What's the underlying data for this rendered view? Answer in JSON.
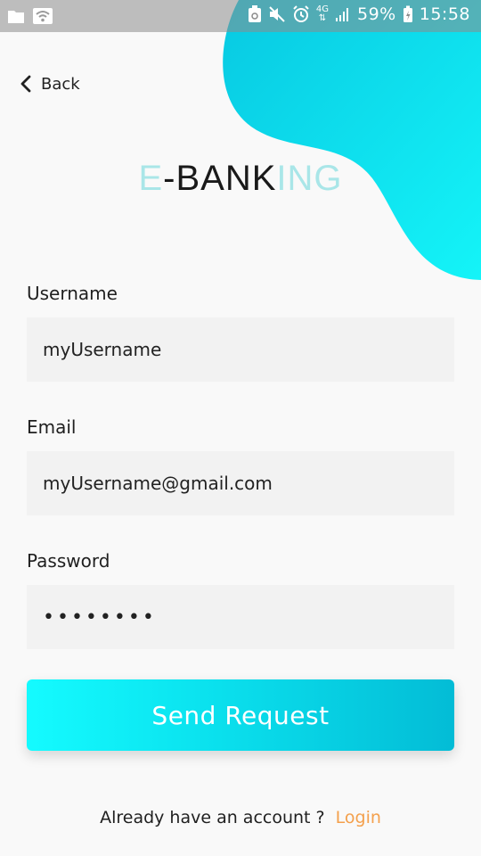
{
  "status_bar": {
    "battery": "59%",
    "time": "15:58",
    "network": "4G"
  },
  "nav": {
    "back_label": "Back"
  },
  "logo": {
    "part1": "E",
    "part2": "-BANK",
    "part3": "ING"
  },
  "form": {
    "username": {
      "label": "Username",
      "value": "myUsername"
    },
    "email": {
      "label": "Email",
      "value": "myUsername@gmail.com"
    },
    "password": {
      "label": "Password",
      "value": "••••••••"
    }
  },
  "actions": {
    "send_label": "Send Request"
  },
  "footer": {
    "prompt": "Already have an account ?",
    "login_label": "Login"
  },
  "colors": {
    "accent": "#0be3ef",
    "accent_dark": "#03bcd6",
    "link": "#f4a04c",
    "logo_light": "#a9e6e8",
    "input_bg": "#f2f2f2"
  },
  "icons": [
    "folder-icon",
    "wifi-icon",
    "recycle-battery-icon",
    "mute-icon",
    "alarm-icon",
    "signal-icon",
    "battery-icon",
    "back-chevron-icon"
  ]
}
